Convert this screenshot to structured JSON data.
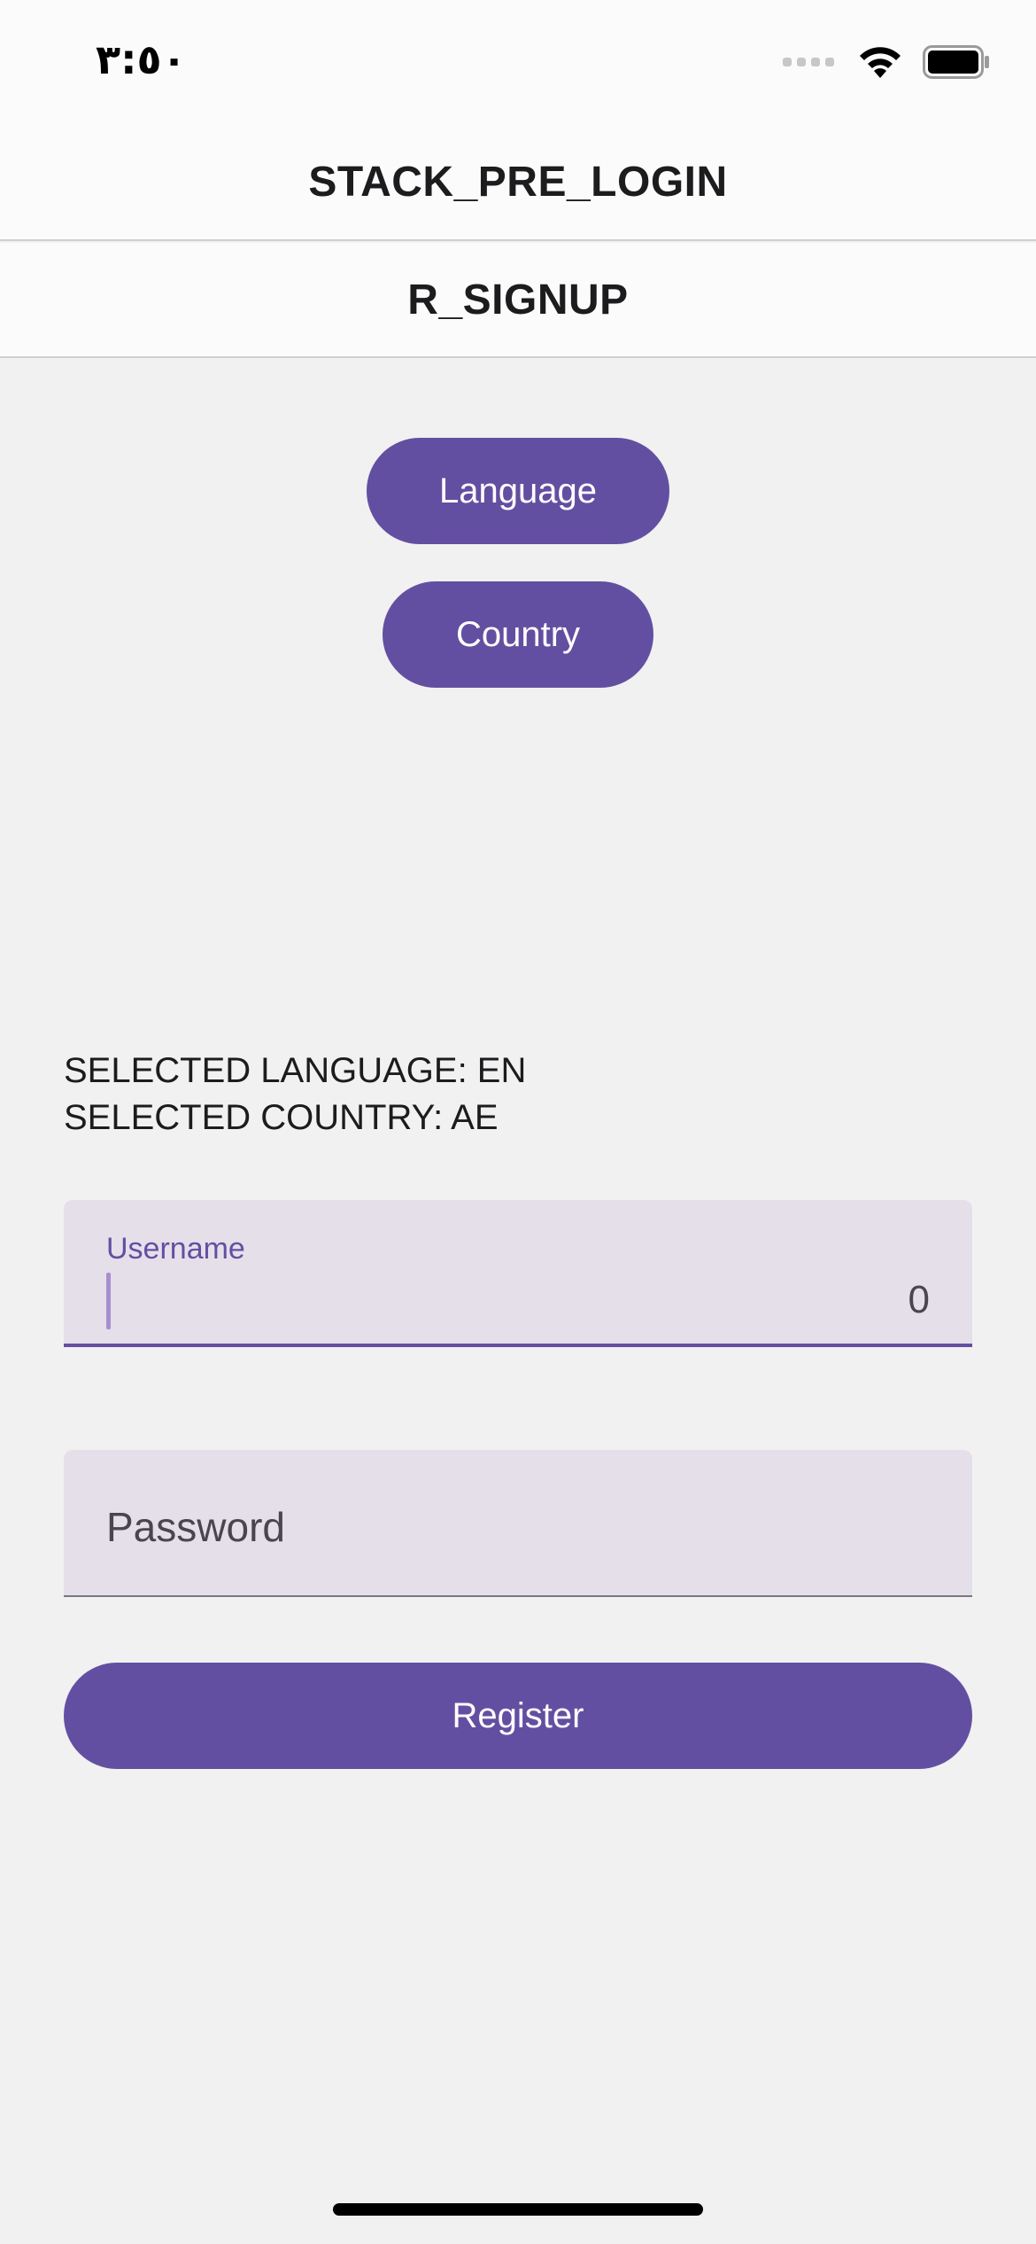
{
  "status_bar": {
    "time": "٣:٥٠",
    "wifi_icon": "wifi-icon",
    "battery_icon": "battery-icon",
    "signal_icon": "cellular-signal-icon"
  },
  "header": {
    "stack_title": "STACK_PRE_LOGIN",
    "screen_title": "R_SIGNUP"
  },
  "actions": {
    "language_label": "Language",
    "country_label": "Country"
  },
  "selection": {
    "language_line": "SELECTED LANGUAGE: EN",
    "country_line": "SELECTED COUNTRY: AE"
  },
  "form": {
    "username": {
      "label": "Username",
      "value": "",
      "counter": "0"
    },
    "password": {
      "placeholder": "Password",
      "value": ""
    },
    "register_label": "Register"
  },
  "colors": {
    "accent": "#634fa1",
    "field_background": "#e5dfea",
    "screen_background": "#f1f1f1",
    "header_background": "#fbfbfb"
  }
}
